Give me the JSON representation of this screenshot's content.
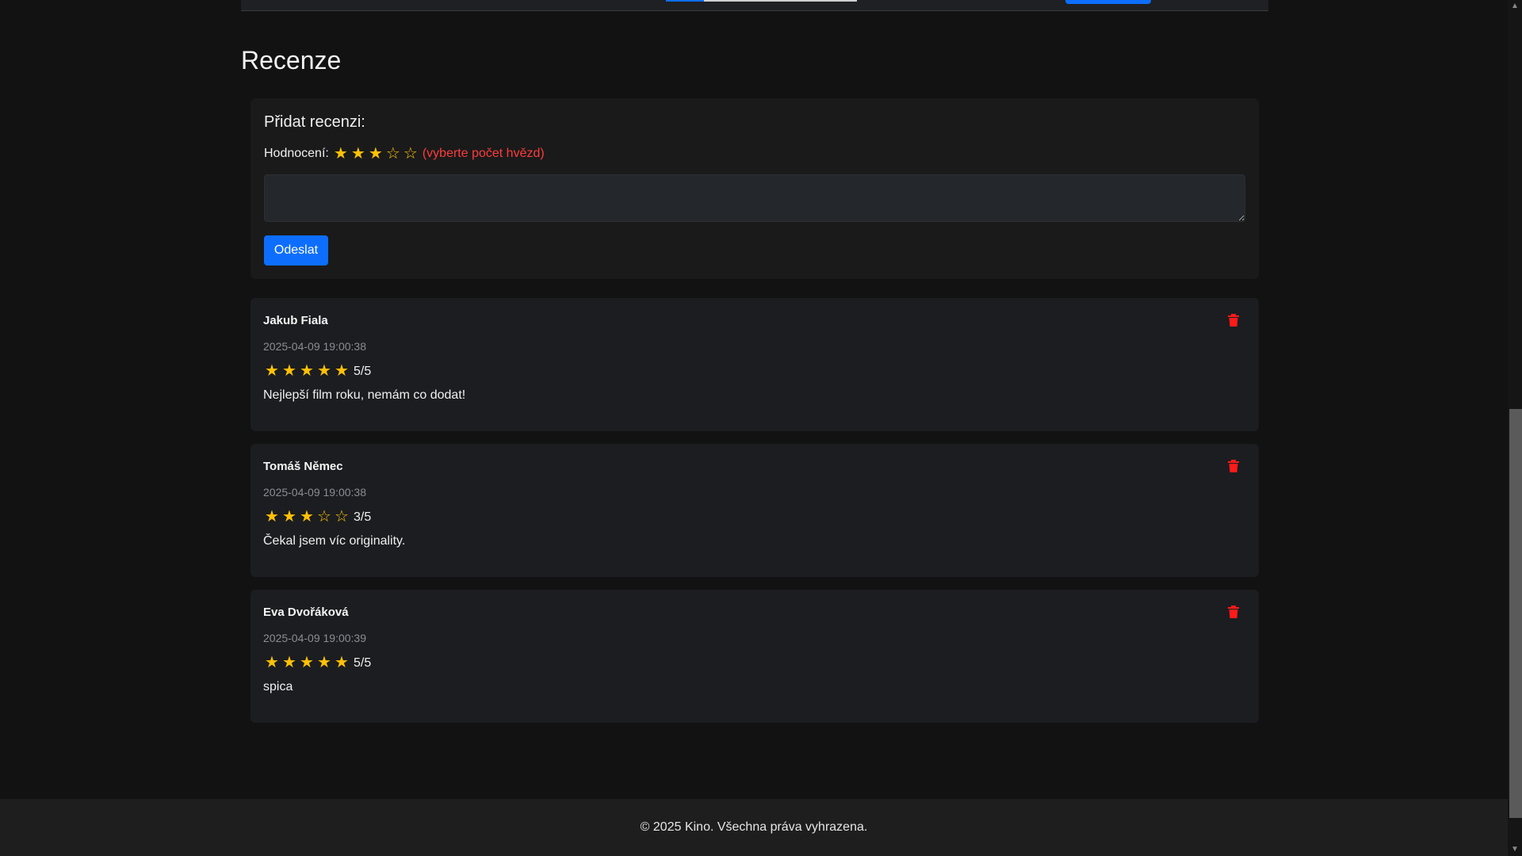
{
  "page": {
    "title": "Recenze"
  },
  "form": {
    "title": "Přidat recenzi:",
    "rating_label": "Hodnocení:",
    "selected_stars": 3,
    "max_stars": 5,
    "hint": "(vyberte počet hvězd)",
    "textarea_value": "",
    "submit_label": "Odeslat"
  },
  "reviews": [
    {
      "author": "Jakub Fiala",
      "date": "2025-04-09 19:00:38",
      "stars": 5,
      "score": "5/5",
      "text": "Nejlepší film roku, nemám co dodat!"
    },
    {
      "author": "Tomáš Němec",
      "date": "2025-04-09 19:00:38",
      "stars": 3,
      "score": "3/5",
      "text": "Čekal jsem víc originality."
    },
    {
      "author": "Eva Dvořáková",
      "date": "2025-04-09 19:00:39",
      "stars": 5,
      "score": "5/5",
      "text": "spica"
    }
  ],
  "footer": {
    "text": "© 2025 Kino. Všechna práva vyhrazena."
  },
  "colors": {
    "accent": "#0d6efd",
    "star": "#ffc107",
    "danger": "#ff1a1a",
    "hint": "#ff3b3b"
  },
  "icons": {
    "star_full": "star-icon",
    "star_empty": "star-outline-icon",
    "delete": "trash-icon"
  }
}
